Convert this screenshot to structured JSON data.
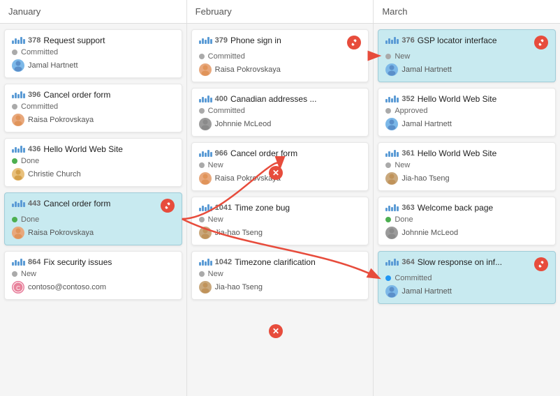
{
  "header": {
    "columns": [
      "January",
      "February",
      "March"
    ]
  },
  "columns": {
    "january": {
      "cards": [
        {
          "id": "378",
          "name": "Request support",
          "status": "Committed",
          "statusType": "committed",
          "assignee": "Jamal Hartnett",
          "assigneeType": "jamal",
          "highlighted": false,
          "hasLink": false
        },
        {
          "id": "396",
          "name": "Cancel order form",
          "status": "Committed",
          "statusType": "committed",
          "assignee": "Raisa Pokrovskaya",
          "assigneeType": "raisa",
          "highlighted": false,
          "hasLink": false
        },
        {
          "id": "436",
          "name": "Hello World Web Site",
          "status": "Done",
          "statusType": "done",
          "assignee": "Christie Church",
          "assigneeType": "christie",
          "highlighted": false,
          "hasLink": false
        },
        {
          "id": "443",
          "name": "Cancel order form",
          "status": "Done",
          "statusType": "done",
          "assignee": "Raisa Pokrovskaya",
          "assigneeType": "raisa",
          "highlighted": true,
          "hasLink": true
        },
        {
          "id": "864",
          "name": "Fix security issues",
          "status": "New",
          "statusType": "new",
          "assignee": "contoso@contoso.com",
          "assigneeType": "contoso",
          "highlighted": false,
          "hasLink": false
        }
      ]
    },
    "february": {
      "cards": [
        {
          "id": "379",
          "name": "Phone sign in",
          "status": "Committed",
          "statusType": "committed",
          "assignee": "Raisa Pokrovskaya",
          "assigneeType": "raisa",
          "highlighted": false,
          "hasLink": false,
          "hasLinkIcon": true
        },
        {
          "id": "400",
          "name": "Canadian addresses ...",
          "status": "Committed",
          "statusType": "committed",
          "assignee": "Johnnie McLeod",
          "assigneeType": "johnnie",
          "highlighted": false,
          "hasLink": false
        },
        {
          "id": "966",
          "name": "Cancel order form",
          "status": "New",
          "statusType": "new",
          "assignee": "Raisa Pokrovskaya",
          "assigneeType": "raisa",
          "highlighted": false,
          "hasLink": false
        },
        {
          "id": "1041",
          "name": "Time zone bug",
          "status": "New",
          "statusType": "new",
          "assignee": "Jia-hao Tseng",
          "assigneeType": "jiahao",
          "highlighted": false,
          "hasLink": false
        },
        {
          "id": "1042",
          "name": "Timezone clarification",
          "status": "New",
          "statusType": "new",
          "assignee": "Jia-hao Tseng",
          "assigneeType": "jiahao",
          "highlighted": false,
          "hasLink": false
        }
      ]
    },
    "march": {
      "cards": [
        {
          "id": "376",
          "name": "GSP locator interface",
          "status": "New",
          "statusType": "new",
          "assignee": "Jamal Hartnett",
          "assigneeType": "jamal",
          "highlighted": true,
          "hasLink": true
        },
        {
          "id": "352",
          "name": "Hello World Web Site",
          "status": "Approved",
          "statusType": "approved",
          "assignee": "Jamal Hartnett",
          "assigneeType": "jamal",
          "highlighted": false,
          "hasLink": false
        },
        {
          "id": "361",
          "name": "Hello World Web Site",
          "status": "New",
          "statusType": "new",
          "assignee": "Jia-hao Tseng",
          "assigneeType": "jiahao",
          "highlighted": false,
          "hasLink": false
        },
        {
          "id": "363",
          "name": "Welcome back page",
          "status": "Done",
          "statusType": "done",
          "assignee": "Johnnie McLeod",
          "assigneeType": "johnnie",
          "highlighted": false,
          "hasLink": false
        },
        {
          "id": "364",
          "name": "Slow response on inf...",
          "status": "Committed",
          "statusType": "committed-blue",
          "assignee": "Jamal Hartnett",
          "assigneeType": "jamal",
          "highlighted": true,
          "hasLink": true
        }
      ]
    }
  },
  "icons": {
    "link": "🔗",
    "x": "✕"
  }
}
